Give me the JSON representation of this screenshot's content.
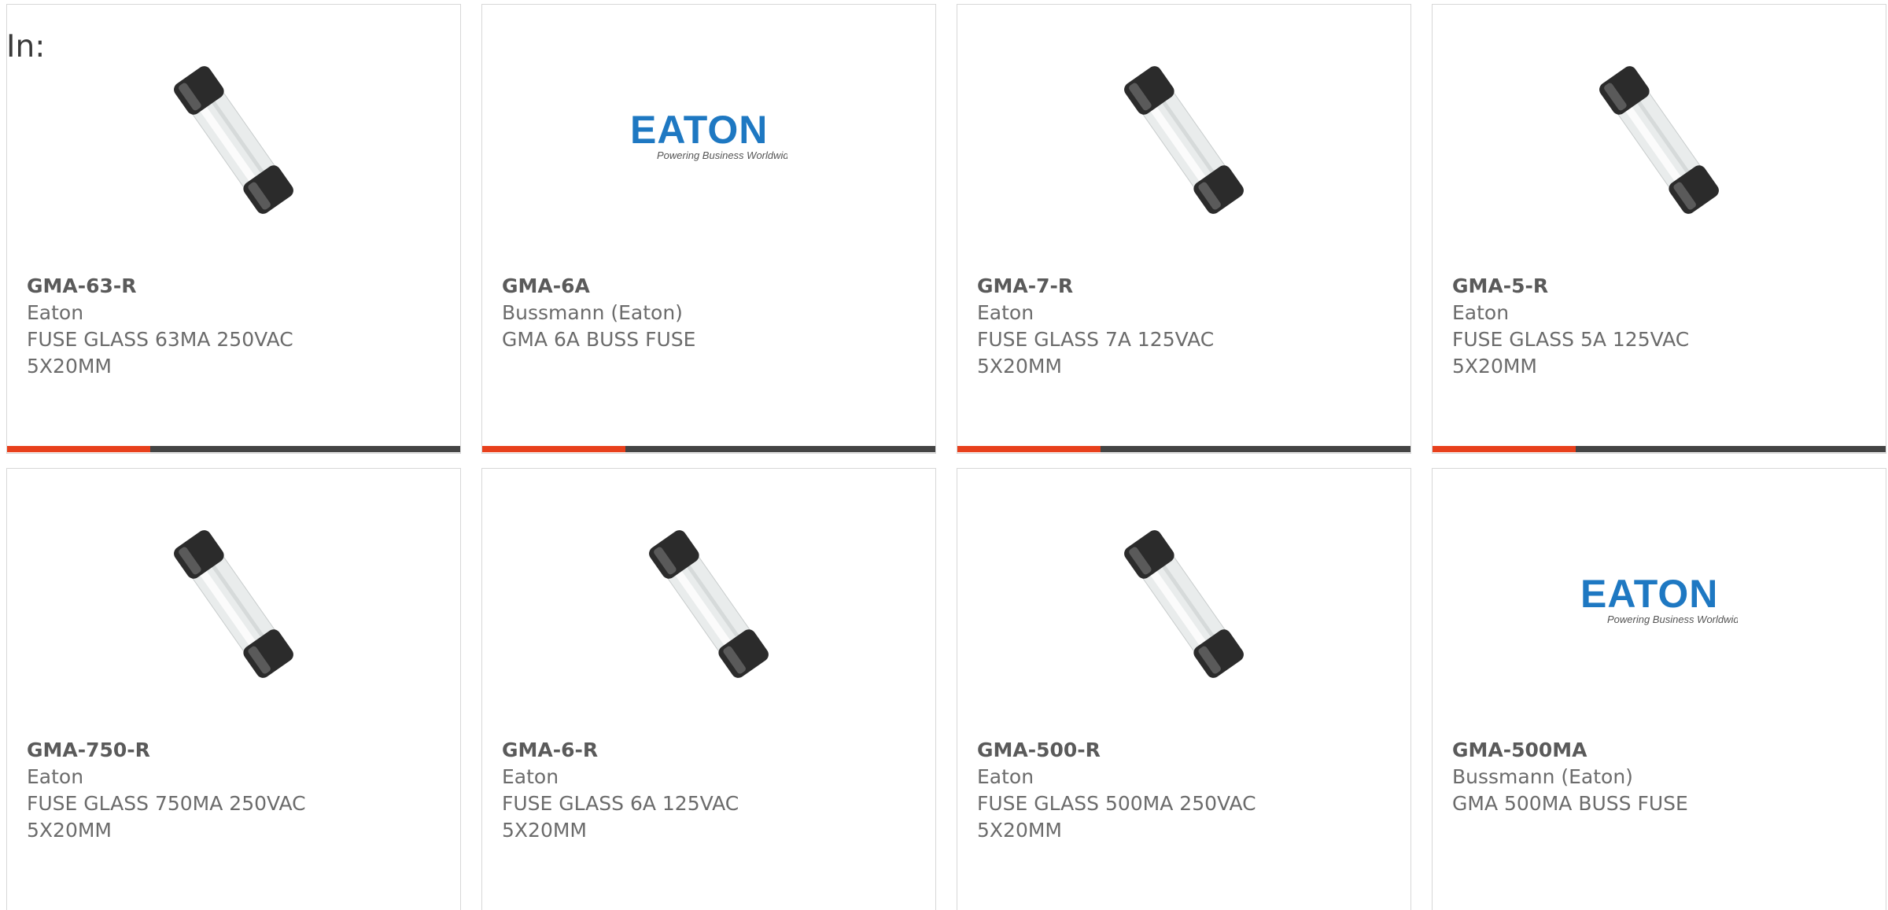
{
  "filter": {
    "label": "In:"
  },
  "colors": {
    "accent": "#e8401c",
    "bar": "#444444",
    "eaton_blue": "#1e78c2"
  },
  "products": [
    {
      "part_number": "GMA-63-R",
      "manufacturer": "Eaton",
      "description": "FUSE GLASS 63MA 250VAC 5X20MM",
      "image": "glass-fuse-image"
    },
    {
      "part_number": "GMA-6A",
      "manufacturer": "Bussmann (Eaton)",
      "description": "GMA 6A BUSS FUSE",
      "image": "eaton-logo-image",
      "logo": {
        "brand": "EATON",
        "tagline": "Powering Business Worldwide"
      }
    },
    {
      "part_number": "GMA-7-R",
      "manufacturer": "Eaton",
      "description": "FUSE GLASS 7A 125VAC 5X20MM",
      "image": "glass-fuse-image"
    },
    {
      "part_number": "GMA-5-R",
      "manufacturer": "Eaton",
      "description": "FUSE GLASS 5A 125VAC 5X20MM",
      "image": "glass-fuse-image"
    },
    {
      "part_number": "GMA-750-R",
      "manufacturer": "Eaton",
      "description": "FUSE GLASS 750MA 250VAC 5X20MM",
      "image": "glass-fuse-image"
    },
    {
      "part_number": "GMA-6-R",
      "manufacturer": "Eaton",
      "description": "FUSE GLASS 6A 125VAC 5X20MM",
      "image": "glass-fuse-image"
    },
    {
      "part_number": "GMA-500-R",
      "manufacturer": "Eaton",
      "description": "FUSE GLASS 500MA 250VAC 5X20MM",
      "image": "glass-fuse-image"
    },
    {
      "part_number": "GMA-500MA",
      "manufacturer": "Bussmann (Eaton)",
      "description": "GMA 500MA BUSS FUSE",
      "image": "eaton-logo-image",
      "logo": {
        "brand": "EATON",
        "tagline": "Powering Business Worldwide"
      }
    }
  ]
}
